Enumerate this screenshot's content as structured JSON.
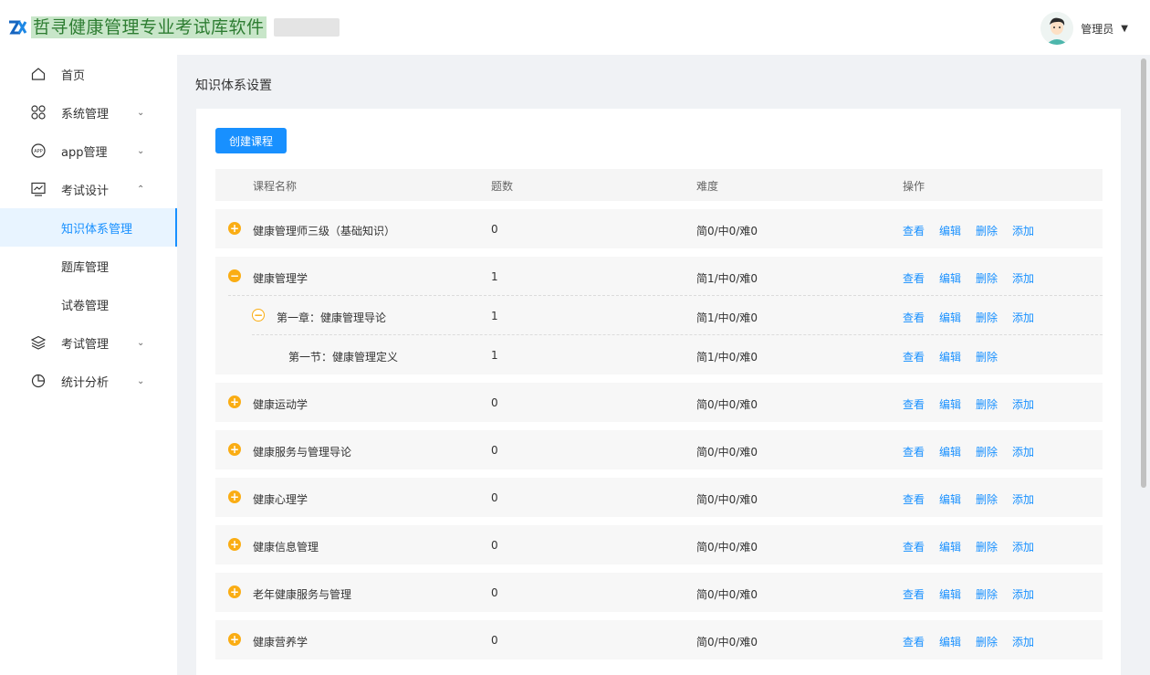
{
  "app": {
    "title": "哲寻健康管理专业考试库软件"
  },
  "user": {
    "name": "管理员"
  },
  "sidebar": {
    "items": [
      {
        "label": "首页",
        "icon": "home-icon"
      },
      {
        "label": "系统管理",
        "icon": "apps-icon"
      },
      {
        "label": "app管理",
        "icon": "app-icon"
      },
      {
        "label": "考试设计",
        "icon": "chart-icon"
      },
      {
        "label": "考试管理",
        "icon": "layers-icon"
      },
      {
        "label": "统计分析",
        "icon": "pie-icon"
      }
    ],
    "sub_items": [
      {
        "label": "知识体系管理"
      },
      {
        "label": "题库管理"
      },
      {
        "label": "试卷管理"
      }
    ]
  },
  "page": {
    "title": "知识体系设置",
    "create_button": "创建课程"
  },
  "table": {
    "headers": {
      "name": "课程名称",
      "count": "题数",
      "difficulty": "难度",
      "ops": "操作"
    },
    "ops": {
      "view": "查看",
      "edit": "编辑",
      "delete": "删除",
      "add": "添加"
    },
    "rows": [
      {
        "name": "健康管理师三级（基础知识）",
        "count": "0",
        "difficulty": "简0/中0/难0"
      },
      {
        "name": "健康管理学",
        "count": "1",
        "difficulty": "简1/中0/难0"
      },
      {
        "name": "第一章：健康管理导论",
        "count": "1",
        "difficulty": "简1/中0/难0"
      },
      {
        "name": "第一节：健康管理定义",
        "count": "1",
        "difficulty": "简1/中0/难0"
      },
      {
        "name": "健康运动学",
        "count": "0",
        "difficulty": "简0/中0/难0"
      },
      {
        "name": "健康服务与管理导论",
        "count": "0",
        "difficulty": "简0/中0/难0"
      },
      {
        "name": "健康心理学",
        "count": "0",
        "difficulty": "简0/中0/难0"
      },
      {
        "name": "健康信息管理",
        "count": "0",
        "difficulty": "简0/中0/难0"
      },
      {
        "name": "老年健康服务与管理",
        "count": "0",
        "difficulty": "简0/中0/难0"
      },
      {
        "name": "健康营养学",
        "count": "0",
        "difficulty": "简0/中0/难0"
      }
    ]
  },
  "colors": {
    "primary": "#1890ff",
    "toggle": "#faad14",
    "brand_green": "#2e7d32"
  }
}
